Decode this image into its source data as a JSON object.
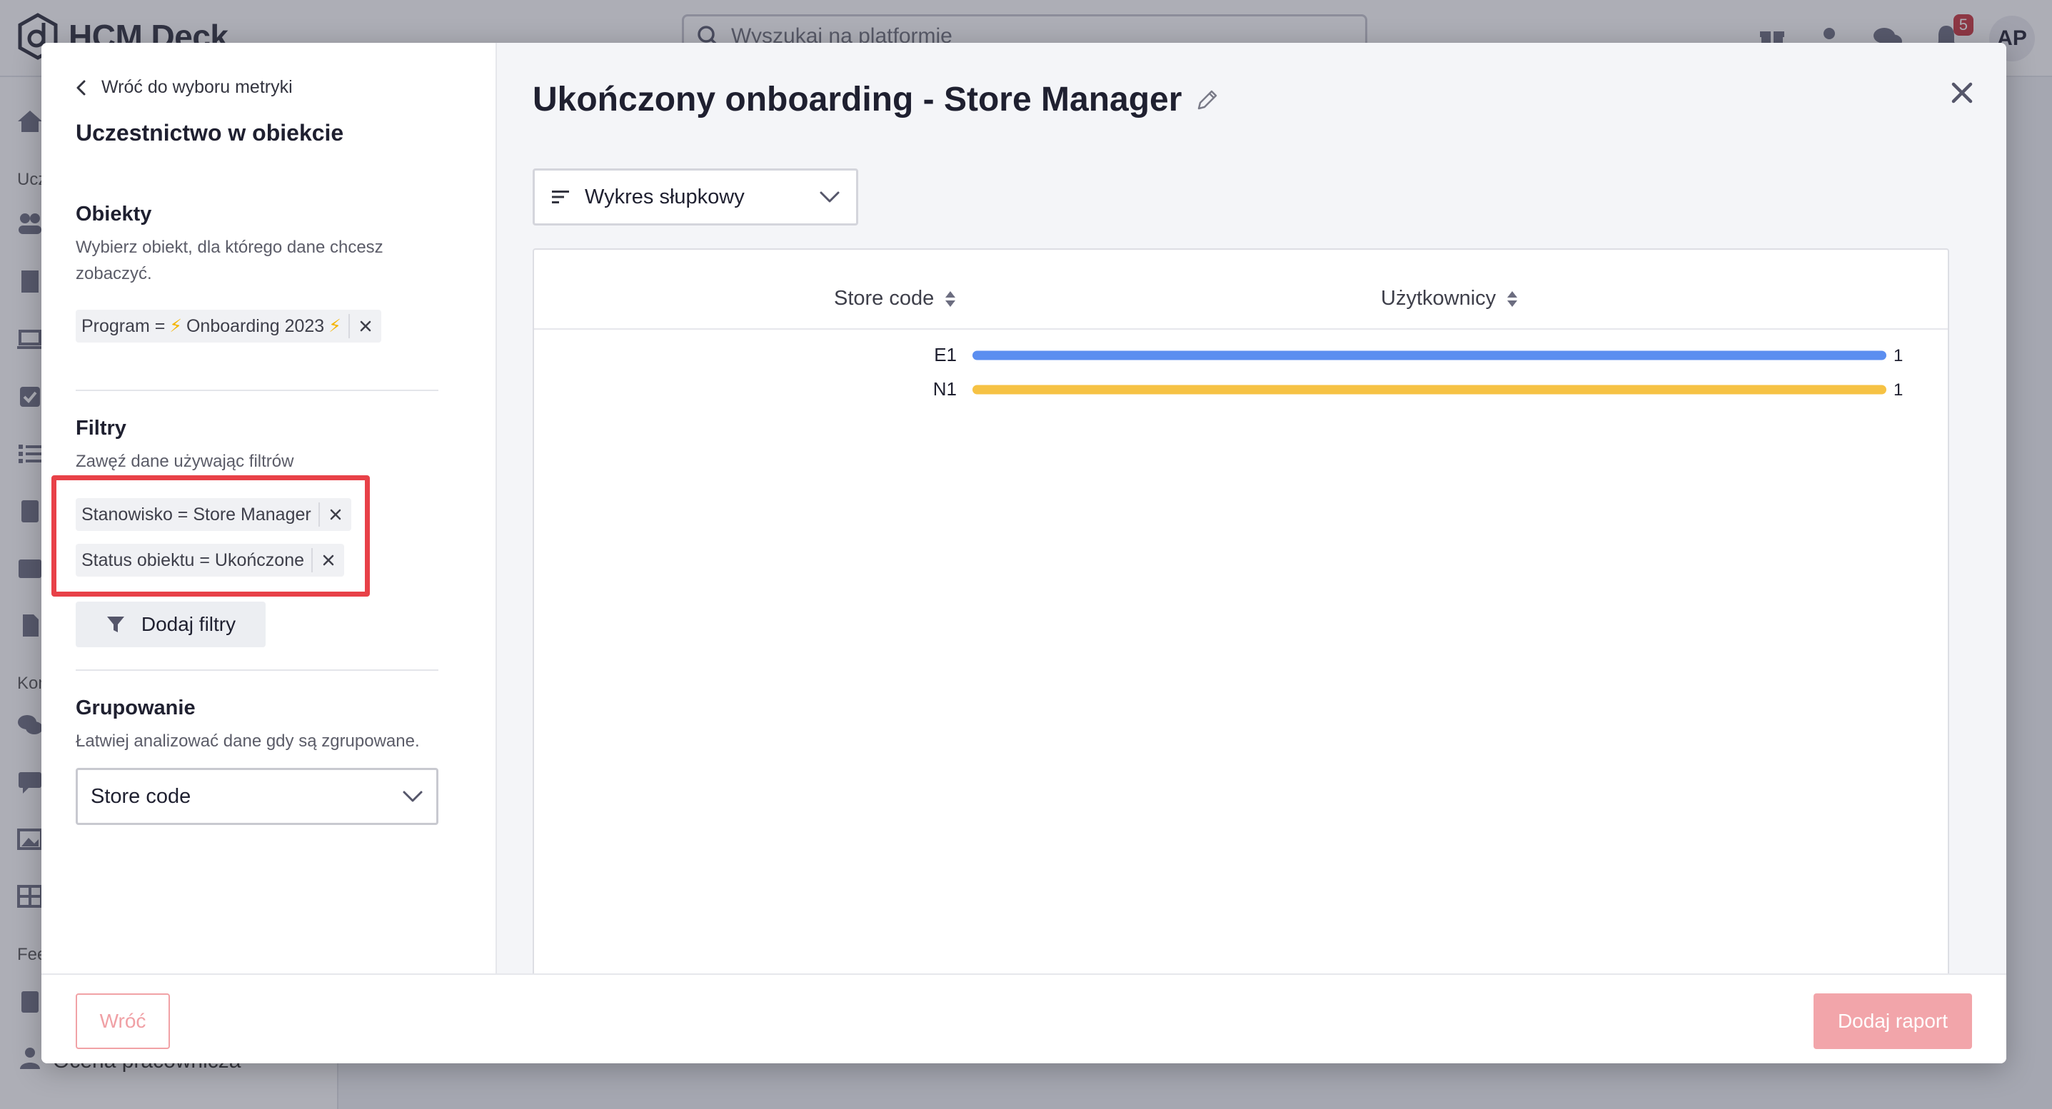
{
  "app": {
    "brand": "HCM Deck",
    "search_placeholder": "Wyszukaj na platformie",
    "notifications_count": "5",
    "user_initials": "AP",
    "sidebar_partial": {
      "section_1": "Ucz",
      "section_2": "Kom",
      "section_3": "Fee",
      "bottom_item": "Ocena pracownicza"
    }
  },
  "left_panel": {
    "back_label": "Wróć do wyboru metryki",
    "metric_title": "Uczestnictwo w obiekcie",
    "objects": {
      "title": "Obiekty",
      "description": "Wybierz obiekt, dla którego dane chcesz zobaczyć.",
      "chip_prefix": "Program =",
      "chip_value": "Onboarding 2023"
    },
    "filters": {
      "title": "Filtry",
      "description": "Zawęź dane używając filtrów",
      "chips": [
        "Stanowisko = Store Manager",
        "Status obiektu = Ukończone"
      ],
      "add_button": "Dodaj filtry"
    },
    "grouping": {
      "title": "Grupowanie",
      "description": "Łatwiej analizować dane gdy są zgrupowane.",
      "selected": "Store code"
    }
  },
  "right_panel": {
    "report_title": "Ukończony onboarding - Store Manager",
    "chart_type": "Wykres słupkowy"
  },
  "footer": {
    "back_button": "Wróć",
    "add_report_button": "Dodaj raport"
  },
  "colors": {
    "bar_e1": "#5b8ef0",
    "bar_n1": "#f6c244",
    "highlight": "#e84148",
    "primary_disabled": "#f2a5aa"
  },
  "chart_data": {
    "type": "bar",
    "orientation": "horizontal",
    "columns": [
      "Store code",
      "Użytkownicy"
    ],
    "categories": [
      "E1",
      "N1"
    ],
    "values": [
      1,
      1
    ],
    "xlim": [
      0,
      1
    ]
  }
}
